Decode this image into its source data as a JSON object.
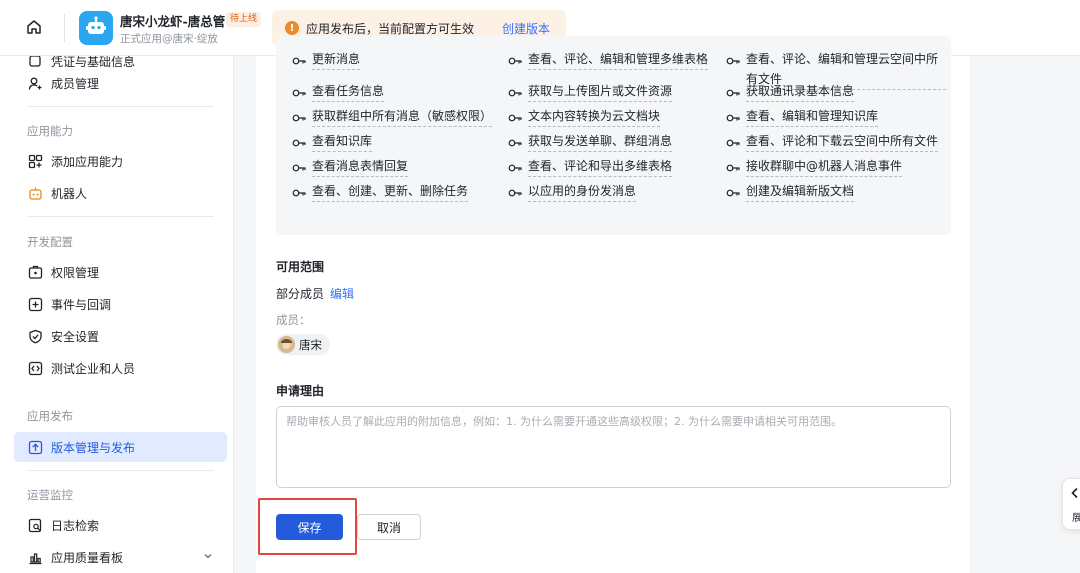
{
  "header": {
    "app_name": "唐宋小龙虾-唐总管",
    "status_badge": "待上线",
    "app_subtitle": "正式应用@唐宋·绽放",
    "notice_text": "应用发布后，当前配置方可生效",
    "notice_link": "创建版本"
  },
  "sidebar": {
    "top_item_partial": "凭证与基础信息",
    "items_group1": [
      {
        "label": "成员管理",
        "icon": "user-add-icon"
      }
    ],
    "section_app": "应用能力",
    "items_app": [
      {
        "label": "添加应用能力",
        "icon": "grid-plus-icon"
      },
      {
        "label": "机器人",
        "icon": "robot-icon"
      }
    ],
    "section_dev": "开发配置",
    "items_dev": [
      {
        "label": "权限管理",
        "icon": "permission-icon"
      },
      {
        "label": "事件与回调",
        "icon": "event-icon"
      },
      {
        "label": "安全设置",
        "icon": "shield-icon"
      },
      {
        "label": "测试企业和人员",
        "icon": "code-icon"
      }
    ],
    "section_release": "应用发布",
    "items_release": [
      {
        "label": "版本管理与发布",
        "icon": "upload-icon",
        "active": true
      }
    ],
    "section_ops": "运营监控",
    "items_ops": [
      {
        "label": "日志检索",
        "icon": "log-search-icon"
      },
      {
        "label": "应用质量看板",
        "icon": "chart-icon"
      }
    ]
  },
  "permissions": {
    "col1": [
      "更新消息",
      "查看任务信息",
      "获取群组中所有消息（敏感权限）",
      "查看知识库",
      "查看消息表情回复",
      "查看、创建、更新、删除任务"
    ],
    "col2": [
      "查看、评论、编辑和管理多维表格",
      "获取与上传图片或文件资源",
      "文本内容转换为云文档块",
      "获取与发送单聊、群组消息",
      "查看、评论和导出多维表格",
      "以应用的身份发消息"
    ],
    "col3": [
      "查看、评论、编辑和管理云空间中所有文件",
      "获取通讯录基本信息",
      "查看、编辑和管理知识库",
      "查看、评论和下载云空间中所有文件",
      "接收群聊中@机器人消息事件",
      "创建及编辑新版文档"
    ]
  },
  "scope": {
    "title": "可用范围",
    "value": "部分成员",
    "edit_label": "编辑",
    "members_label": "成员：",
    "member_name": "唐宋"
  },
  "reason": {
    "title": "申请理由",
    "placeholder": "帮助审核人员了解此应用的附加信息，例如：1. 为什么需要开通这些高级权限；2. 为什么需要申请相关可用范围。"
  },
  "actions": {
    "save_label": "保存",
    "cancel_label": "取消"
  },
  "float_panel": {
    "label": "展"
  },
  "colors": {
    "accent": "#245bdb",
    "link": "#3370ff",
    "highlight": "#e3463f",
    "notice_bg": "#fdf0e4"
  }
}
